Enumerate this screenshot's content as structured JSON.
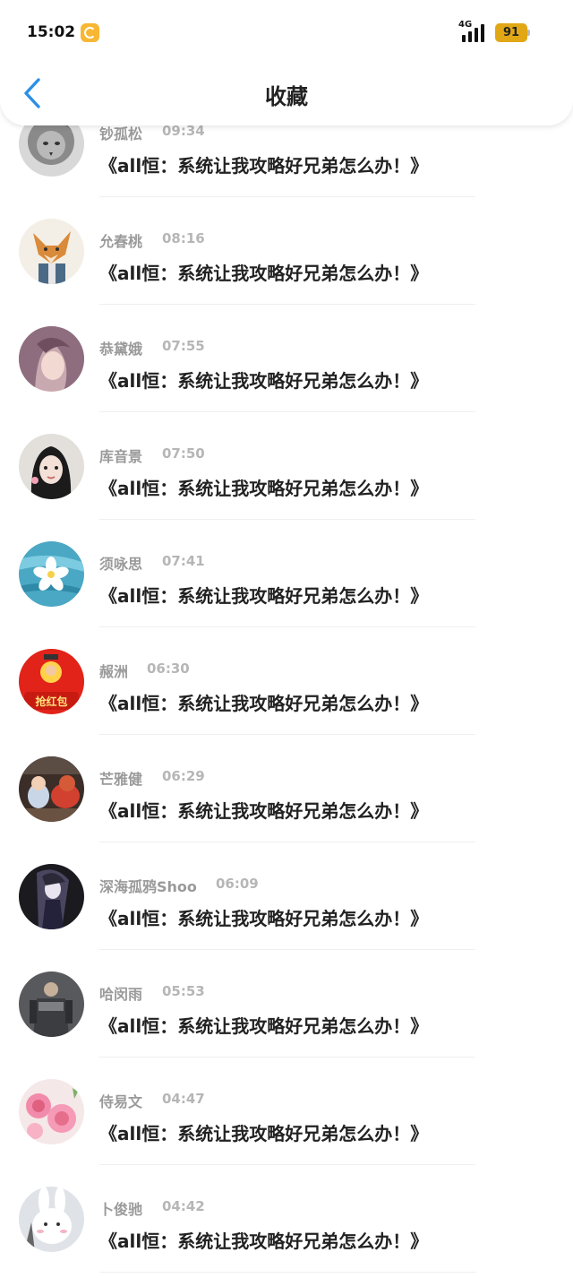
{
  "status_bar": {
    "time": "15:02",
    "network": "4G",
    "battery": "91",
    "app_icon": "refresh-app-icon"
  },
  "header": {
    "title": "收藏",
    "back_icon": "chevron-left-icon"
  },
  "favorites": [
    {
      "name": "钞孤松",
      "time": "09:34",
      "title": "《all恒：系统让我攻略好兄弟怎么办！》",
      "avatar": "lion-sketch"
    },
    {
      "name": "允春桃",
      "time": "08:16",
      "title": "《all恒：系统让我攻略好兄弟怎么办！》",
      "avatar": "fox-cartoon"
    },
    {
      "name": "恭黛娥",
      "time": "07:55",
      "title": "《all恒：系统让我攻略好兄弟怎么办！》",
      "avatar": "anime-girl"
    },
    {
      "name": "库音景",
      "time": "07:50",
      "title": "《all恒：系统让我攻略好兄弟怎么办！》",
      "avatar": "selfie-girl"
    },
    {
      "name": "须咏思",
      "time": "07:41",
      "title": "《all恒：系统让我攻略好兄弟怎么办！》",
      "avatar": "flower-water"
    },
    {
      "name": "赧洲",
      "time": "06:30",
      "title": "《all恒：系统让我攻略好兄弟怎么办！》",
      "avatar": "red-envelope",
      "avatar_text": "抢红包"
    },
    {
      "name": "芒雅健",
      "time": "06:29",
      "title": "《all恒：系统让我攻略好兄弟怎么办！》",
      "avatar": "child-dog"
    },
    {
      "name": "深海孤鸦Shoo",
      "time": "06:09",
      "title": "《all恒：系统让我攻略好兄弟怎么办！》",
      "avatar": "dark-anime"
    },
    {
      "name": "哈闵雨",
      "time": "05:53",
      "title": "《all恒：系统让我攻略好兄弟怎么办！》",
      "avatar": "game-soldier"
    },
    {
      "name": "侍易文",
      "time": "04:47",
      "title": "《all恒：系统让我攻略好兄弟怎么办！》",
      "avatar": "pink-roses"
    },
    {
      "name": "卜俊驰",
      "time": "04:42",
      "title": "《all恒：系统让我攻略好兄弟怎么办！》",
      "avatar": "rabbit-plush"
    }
  ]
}
